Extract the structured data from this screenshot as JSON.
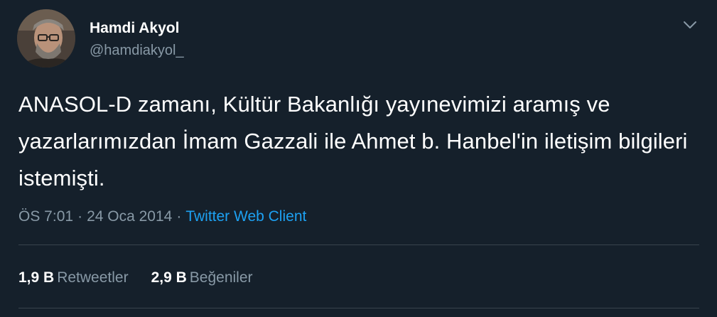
{
  "author": {
    "name": "Hamdi Akyol",
    "handle": "@hamdiakyol_",
    "avatar": "profile-photo"
  },
  "tweet": {
    "text": "ANASOL-D zamanı, Kültür Bakanlığı yayınevimizi aramış ve yazarlarımızdan İmam Gazzali ile Ahmet b. Hanbel'in iletişim bilgileri istemişti.",
    "time": "ÖS 7:01",
    "separator": "·",
    "date": "24 Oca 2014",
    "source": "Twitter Web Client"
  },
  "stats": {
    "retweets_count": "1,9 B",
    "retweets_label": "Retweetler",
    "likes_count": "2,9 B",
    "likes_label": "Beğeniler"
  },
  "icons": {
    "menu": "chevron-down-icon"
  },
  "colors": {
    "background": "#15202b",
    "text": "#ffffff",
    "secondary_text": "#8899a6",
    "link": "#1da1f2",
    "divider": "#38444d"
  }
}
